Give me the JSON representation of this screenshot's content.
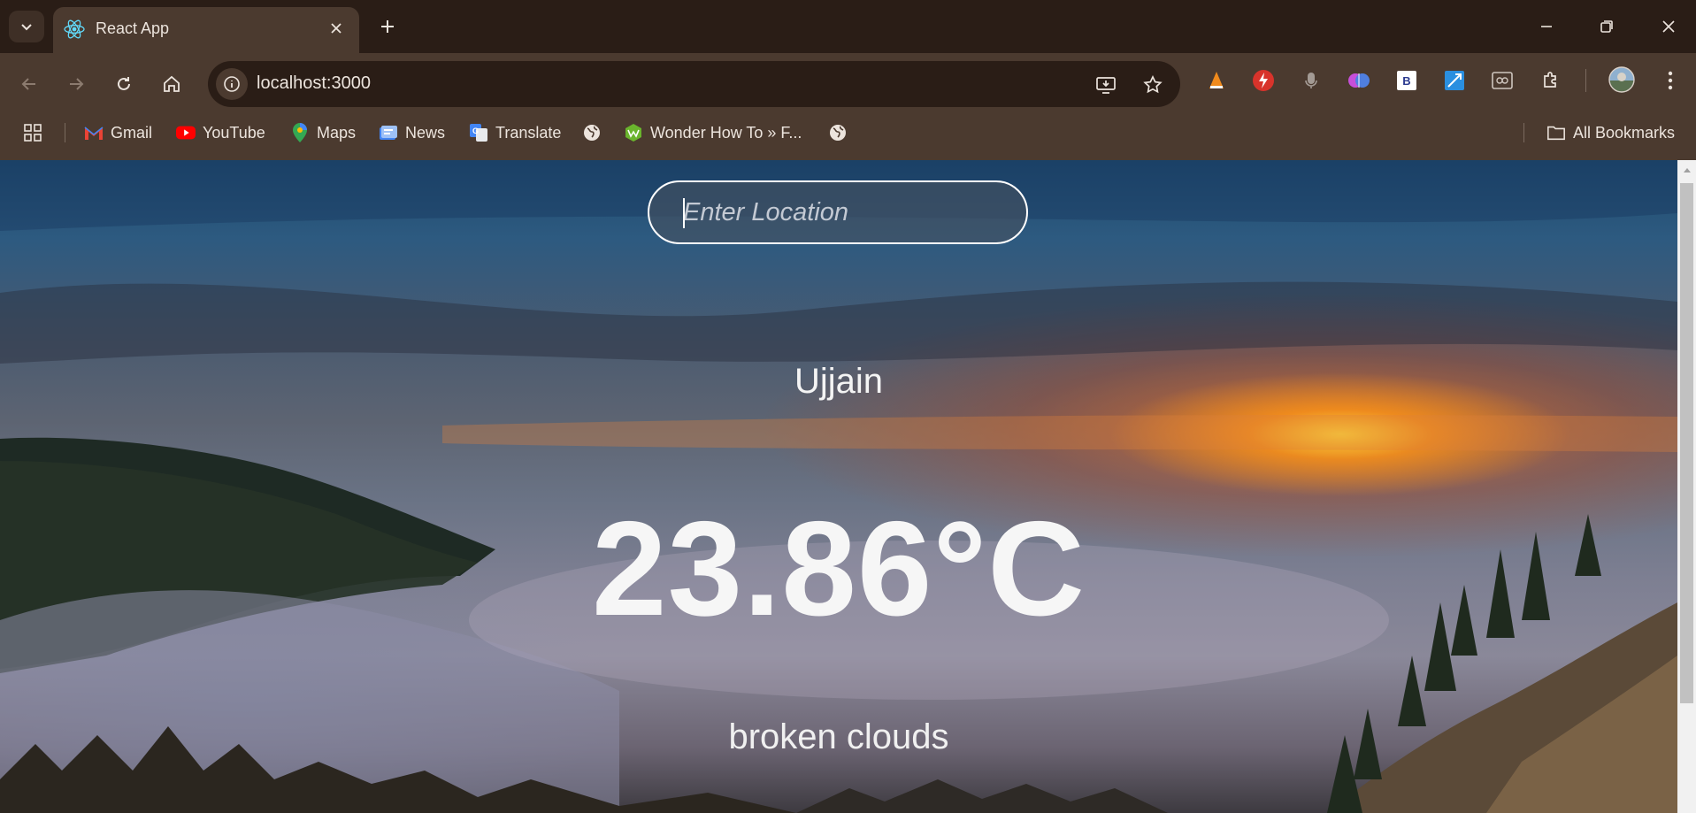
{
  "browser": {
    "tab": {
      "title": "React App"
    },
    "address_bar": {
      "url": "localhost:3000"
    },
    "bookmarks": [
      {
        "label": "Gmail",
        "icon": "gmail-icon"
      },
      {
        "label": "YouTube",
        "icon": "youtube-icon"
      },
      {
        "label": "Maps",
        "icon": "maps-icon"
      },
      {
        "label": "News",
        "icon": "news-icon"
      },
      {
        "label": "Translate",
        "icon": "translate-icon"
      },
      {
        "label": "",
        "icon": "globe-icon"
      },
      {
        "label": "Wonder How To » F...",
        "icon": "wonderhowto-icon"
      },
      {
        "label": "",
        "icon": "globe-icon"
      }
    ],
    "all_bookmarks_label": "All Bookmarks",
    "colors": {
      "frame": "#2a1d16",
      "toolbar": "#4b3a2f",
      "text": "#ece4dd"
    }
  },
  "weather": {
    "search": {
      "placeholder": "Enter Location",
      "value": ""
    },
    "city": "Ujjain",
    "temperature": "23.86°C",
    "description": "broken clouds"
  }
}
